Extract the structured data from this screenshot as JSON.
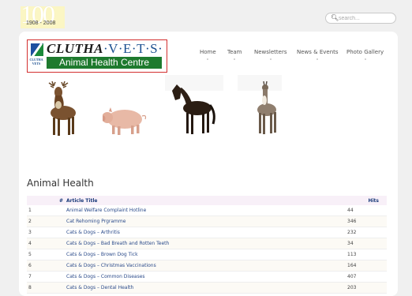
{
  "centennial": {
    "big": "100",
    "years": "1908 - 2008"
  },
  "search": {
    "placeholder": "search..."
  },
  "logo": {
    "emblem_text": "CLUTHA VETS",
    "title_main": "CLUTHA",
    "title_vets": "·V·E·T·S·",
    "subtitle": "Animal Health Centre"
  },
  "nav": [
    "Home",
    "Team",
    "Newsletters",
    "News & Events",
    "Photo Gallery"
  ],
  "animals": [
    "deer-image",
    "pig-image",
    "horse-image",
    "llama-image"
  ],
  "section_title": "Animal Health",
  "table": {
    "headers": {
      "num": "#",
      "title": "Article Title",
      "hits": "Hits"
    },
    "rows": [
      {
        "num": "1",
        "title": "Animal Welfare Complaint Hotline",
        "hits": "44"
      },
      {
        "num": "2",
        "title": "Cat Rehoming Prgramme",
        "hits": "346"
      },
      {
        "num": "3",
        "title": "Cats & Dogs – Arthritis",
        "hits": "232"
      },
      {
        "num": "4",
        "title": "Cats & Dogs – Bad Breath and Rotten Teeth",
        "hits": "34"
      },
      {
        "num": "5",
        "title": "Cats & Dogs – Brown Dog Tick",
        "hits": "113"
      },
      {
        "num": "6",
        "title": "Cats & Dogs – Christmas Vaccinations",
        "hits": "164"
      },
      {
        "num": "7",
        "title": "Cats & Dogs – Common Diseases",
        "hits": "407"
      },
      {
        "num": "8",
        "title": "Cats & Dogs – Dental Health",
        "hits": "203"
      }
    ]
  },
  "colors": {
    "brand_green": "#1e7a2e",
    "brand_blue": "#1a4e8f",
    "logo_border": "#d32f2f"
  }
}
